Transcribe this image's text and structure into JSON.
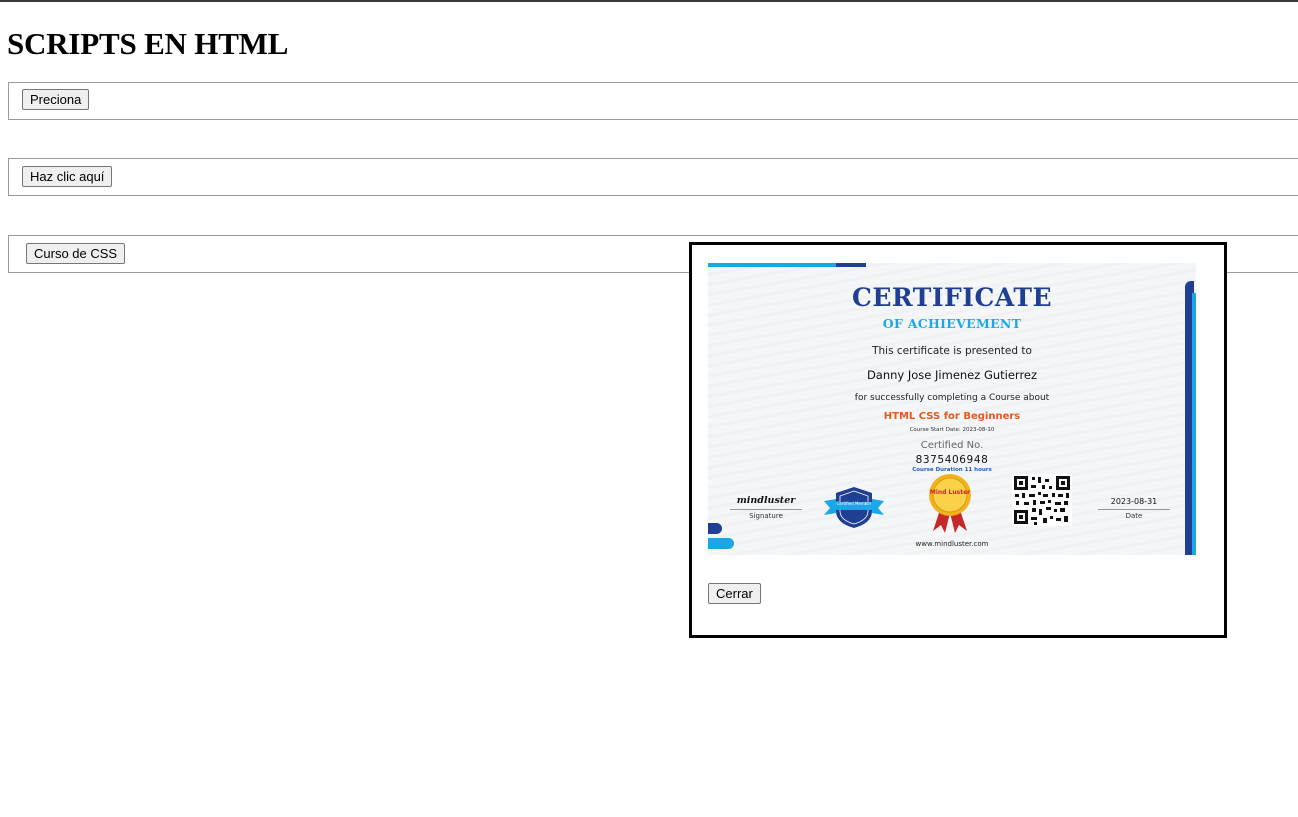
{
  "page": {
    "title": "SCRIPTS EN HTML"
  },
  "buttons": {
    "preciona": "Preciona",
    "haz_clic": "Haz clic aquí",
    "curso_css": "Curso de CSS"
  },
  "modal": {
    "close_label": "Cerrar",
    "certificate": {
      "title": "CERTIFICATE",
      "subtitle": "OF ACHIEVEMENT",
      "presented_to": "This certificate is presented to",
      "recipient": "Danny Jose Jimenez Gutierrez",
      "completing": "for successfully completing a Course about",
      "course_name": "HTML CSS for Beginners",
      "start_date": "Course Start Date: 2023-08-10",
      "certified_label": "Certified No.",
      "certified_number": "8375406948",
      "duration": "Course Duration 11 hours",
      "signature_name": "mindluster",
      "signature_label": "Signature",
      "date_value": "2023-08-31",
      "date_label": "Date",
      "member_badge": "Certified Member",
      "seal_text": "Mind Luster",
      "website": "www.mindluster.com"
    }
  },
  "colors": {
    "navy": "#1f3f93",
    "cyan": "#1aa7e6",
    "orange": "#e8591a",
    "gold": "#f3b21b",
    "ribbon_red": "#c62828"
  }
}
